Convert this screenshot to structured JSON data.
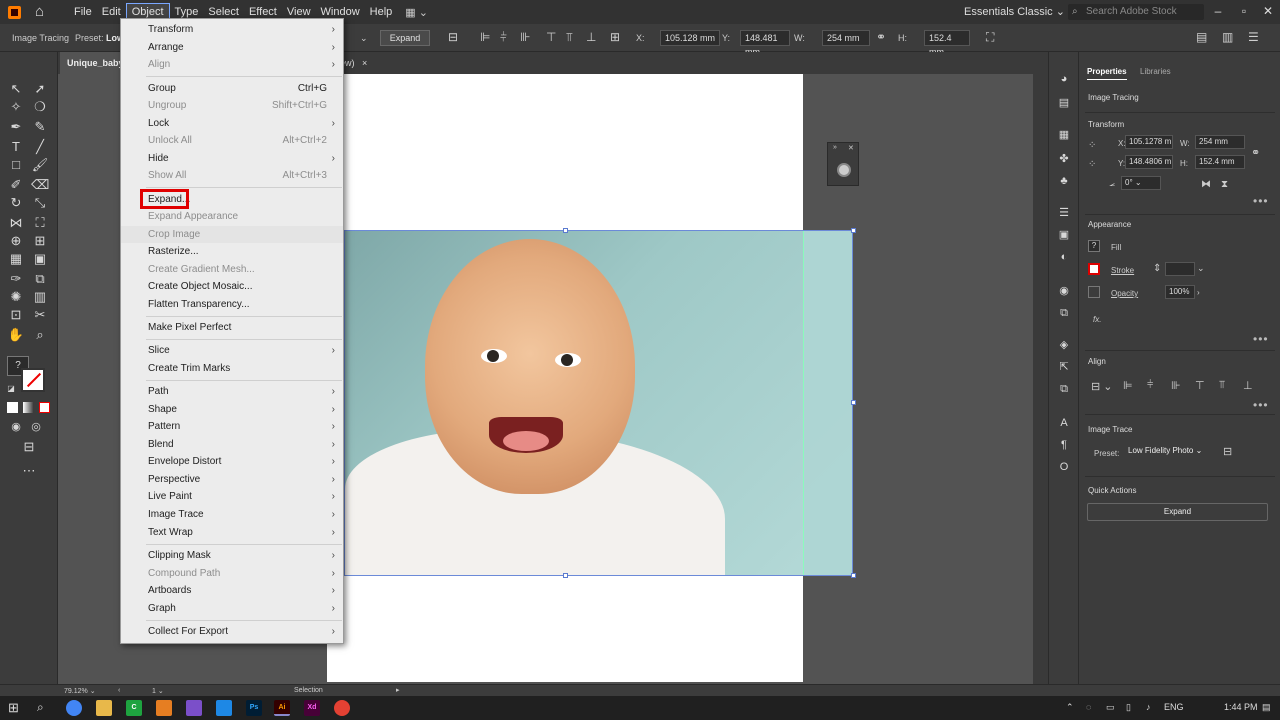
{
  "menubar": {
    "items": [
      "File",
      "Edit",
      "Object",
      "Type",
      "Select",
      "Effect",
      "View",
      "Window",
      "Help"
    ],
    "workspace": "Essentials Classic",
    "search_placeholder": "Search Adobe Stock"
  },
  "control_bar": {
    "image_tracing_label": "Image Tracing",
    "preset_label": "Preset:",
    "preset_value": "Low",
    "expand_label": "Expand",
    "x_label": "X:",
    "x_value": "105.128 mm",
    "y_label": "Y:",
    "y_value": "148.481 mm",
    "w_label": "W:",
    "w_value": "254 mm",
    "h_label": "H:",
    "h_value": "152.4 mm"
  },
  "document_tabs": {
    "active": "Unique_baby",
    "second_fragment": "ew)",
    "close_symbol": "×"
  },
  "object_menu": {
    "items": [
      {
        "label": "Transform",
        "shortcut": "",
        "submenu": true,
        "disabled": false
      },
      {
        "label": "Arrange",
        "shortcut": "",
        "submenu": true,
        "disabled": false
      },
      {
        "label": "Align",
        "shortcut": "",
        "submenu": true,
        "disabled": true
      },
      {
        "label": "Group",
        "shortcut": "Ctrl+G",
        "submenu": false,
        "disabled": false
      },
      {
        "label": "Ungroup",
        "shortcut": "Shift+Ctrl+G",
        "submenu": false,
        "disabled": true
      },
      {
        "label": "Lock",
        "shortcut": "",
        "submenu": true,
        "disabled": false
      },
      {
        "label": "Unlock All",
        "shortcut": "Alt+Ctrl+2",
        "submenu": false,
        "disabled": true
      },
      {
        "label": "Hide",
        "shortcut": "",
        "submenu": true,
        "disabled": false
      },
      {
        "label": "Show All",
        "shortcut": "Alt+Ctrl+3",
        "submenu": false,
        "disabled": true
      },
      {
        "label": "Expand...",
        "shortcut": "",
        "submenu": false,
        "disabled": false
      },
      {
        "label": "Expand Appearance",
        "shortcut": "",
        "submenu": false,
        "disabled": true
      },
      {
        "label": "Crop Image",
        "shortcut": "",
        "submenu": false,
        "disabled": true
      },
      {
        "label": "Rasterize...",
        "shortcut": "",
        "submenu": false,
        "disabled": false
      },
      {
        "label": "Create Gradient Mesh...",
        "shortcut": "",
        "submenu": false,
        "disabled": true
      },
      {
        "label": "Create Object Mosaic...",
        "shortcut": "",
        "submenu": false,
        "disabled": false
      },
      {
        "label": "Flatten Transparency...",
        "shortcut": "",
        "submenu": false,
        "disabled": false
      },
      {
        "label": "Make Pixel Perfect",
        "shortcut": "",
        "submenu": false,
        "disabled": false
      },
      {
        "label": "Slice",
        "shortcut": "",
        "submenu": true,
        "disabled": false
      },
      {
        "label": "Create Trim Marks",
        "shortcut": "",
        "submenu": false,
        "disabled": false
      },
      {
        "label": "Path",
        "shortcut": "",
        "submenu": true,
        "disabled": false
      },
      {
        "label": "Shape",
        "shortcut": "",
        "submenu": true,
        "disabled": false
      },
      {
        "label": "Pattern",
        "shortcut": "",
        "submenu": true,
        "disabled": false
      },
      {
        "label": "Blend",
        "shortcut": "",
        "submenu": true,
        "disabled": false
      },
      {
        "label": "Envelope Distort",
        "shortcut": "",
        "submenu": true,
        "disabled": false
      },
      {
        "label": "Perspective",
        "shortcut": "",
        "submenu": true,
        "disabled": false
      },
      {
        "label": "Live Paint",
        "shortcut": "",
        "submenu": true,
        "disabled": false
      },
      {
        "label": "Image Trace",
        "shortcut": "",
        "submenu": true,
        "disabled": false
      },
      {
        "label": "Text Wrap",
        "shortcut": "",
        "submenu": true,
        "disabled": false
      },
      {
        "label": "Clipping Mask",
        "shortcut": "",
        "submenu": true,
        "disabled": false
      },
      {
        "label": "Compound Path",
        "shortcut": "",
        "submenu": true,
        "disabled": true
      },
      {
        "label": "Artboards",
        "shortcut": "",
        "submenu": true,
        "disabled": false
      },
      {
        "label": "Graph",
        "shortcut": "",
        "submenu": true,
        "disabled": false
      },
      {
        "label": "Collect For Export",
        "shortcut": "",
        "submenu": true,
        "disabled": false
      }
    ]
  },
  "properties_panel": {
    "tab_properties": "Properties",
    "tab_libraries": "Libraries",
    "selection_type": "Image Tracing",
    "transform_title": "Transform",
    "x_label": "X:",
    "x_value": "105.1278 m",
    "y_label": "Y:",
    "y_value": "148.4806 m",
    "w_label": "W:",
    "w_value": "254 mm",
    "h_label": "H:",
    "h_value": "152.4 mm",
    "rotate_value": "0°",
    "appearance_title": "Appearance",
    "fill_label": "Fill",
    "stroke_label": "Stroke",
    "opacity_label": "Opacity",
    "opacity_value": "100%",
    "fx_label": "fx.",
    "align_title": "Align",
    "image_trace_title": "Image Trace",
    "preset_label": "Preset:",
    "preset_value": "Low Fidelity Photo",
    "quick_actions_title": "Quick Actions",
    "expand_button": "Expand"
  },
  "status_bar": {
    "zoom": "79.12%",
    "artboard_num": "1",
    "tool": "Selection"
  },
  "taskbar": {
    "lang": "ENG",
    "time": "1:44 PM",
    "apps": [
      "Ps",
      "Ai",
      "Xd"
    ]
  },
  "colors": {
    "accent_red_highlight": "#e00000",
    "illustrator_orange": "#ff7c00",
    "selection_blue": "#5b7bd0"
  }
}
